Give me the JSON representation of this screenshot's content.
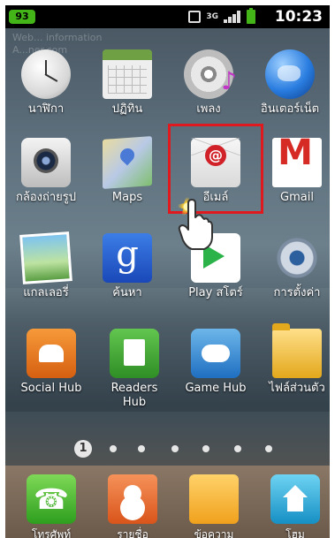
{
  "status_bar": {
    "notification_count": "93",
    "network_label": "3G",
    "time": "10:23"
  },
  "watermark": {
    "line1": "Web... information",
    "line2": "A...ner.com"
  },
  "home_grid": [
    {
      "label": "นาฬิกา",
      "icon": "clock-icon"
    },
    {
      "label": "ปฏิทิน",
      "icon": "calendar-icon"
    },
    {
      "label": "เพลง",
      "icon": "music-icon"
    },
    {
      "label": "อินเตอร์เน็ต",
      "icon": "internet-icon"
    },
    {
      "label": "กล้องถ่ายรูป",
      "icon": "camera-icon"
    },
    {
      "label": "Maps",
      "icon": "maps-icon"
    },
    {
      "label": "อีเมล์",
      "icon": "email-icon"
    },
    {
      "label": "Gmail",
      "icon": "gmail-icon"
    },
    {
      "label": "แกลเลอรี่",
      "icon": "gallery-icon"
    },
    {
      "label": "ค้นหา",
      "icon": "search-icon"
    },
    {
      "label": "Play สโตร์",
      "icon": "play-store-icon"
    },
    {
      "label": "การตั้งค่า",
      "icon": "settings-icon"
    },
    {
      "label": "Social Hub",
      "icon": "social-hub-icon"
    },
    {
      "label": "Readers Hub",
      "icon": "readers-hub-icon"
    },
    {
      "label": "Game Hub",
      "icon": "game-hub-icon"
    },
    {
      "label": "ไฟล์ส่วนตัว",
      "icon": "my-files-icon"
    }
  ],
  "pager": {
    "current_page": "1",
    "page_count": 7
  },
  "dock": [
    {
      "label": "โทรศัพท์",
      "icon": "phone-icon"
    },
    {
      "label": "รายชื่อ",
      "icon": "contacts-icon"
    },
    {
      "label": "ข้อความ",
      "icon": "messaging-icon"
    },
    {
      "label": "โฮม",
      "icon": "home-icon"
    }
  ],
  "highlight_color": "#e0191f"
}
